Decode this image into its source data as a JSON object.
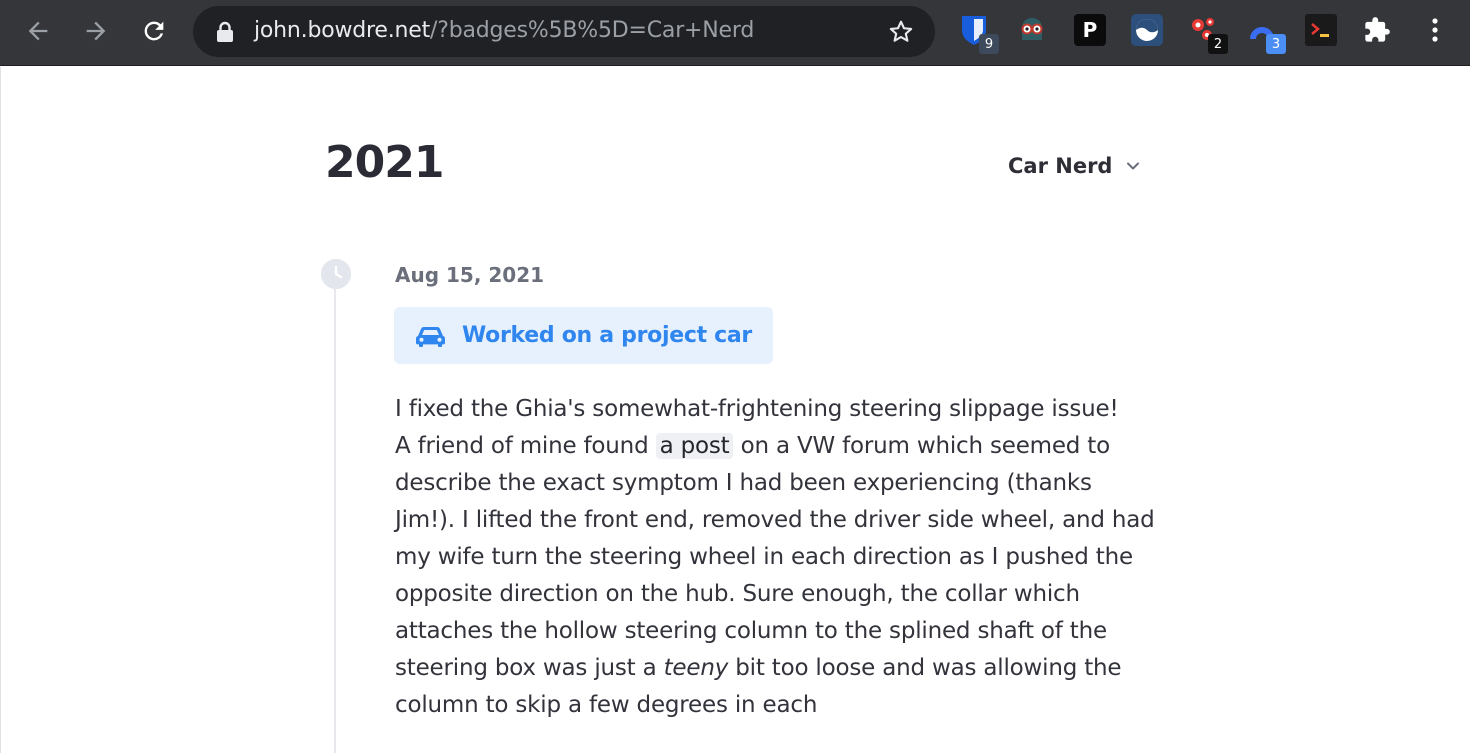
{
  "browser": {
    "url_host": "john.bowdre.net",
    "url_path": "/?badges%5B%5D=Car+Nerd",
    "extensions": [
      {
        "name": "bitwarden-extension",
        "badge": "9",
        "badge_color": "#3d4a5c"
      },
      {
        "name": "spy-extension",
        "badge": null
      },
      {
        "name": "pushbullet-extension",
        "badge": null
      },
      {
        "name": "sphere-extension",
        "badge": null
      },
      {
        "name": "red-dots-extension",
        "badge": "2",
        "badge_color": "#111111"
      },
      {
        "name": "blue-arc-extension",
        "badge": "3",
        "badge_color": "#4b8ff5"
      },
      {
        "name": "terminal-extension",
        "badge": null
      }
    ]
  },
  "page": {
    "year": "2021",
    "filter_label": "Car Nerd",
    "entry": {
      "date": "Aug 15, 2021",
      "badge_label": "Worked on a project car",
      "badge_color": "#2f86ef",
      "line1": "I fixed the Ghia's somewhat-frightening steering slippage issue!",
      "p2_before_link": "A friend of mine found ",
      "link_text": "a post",
      "p2_after_link": " on a VW forum which seemed to describe the exact symptom I had been experiencing (thanks Jim!). I lifted the front end, removed the driver side wheel, and had my wife turn the steering wheel in each direction as I pushed the opposite direction on the hub. Sure enough, the collar which attaches the hollow steering column to the splined shaft of the steering box was just a ",
      "emphasis": "teeny",
      "p2_after_emphasis": " bit too loose and was allowing the column to skip a few degrees in each"
    }
  }
}
